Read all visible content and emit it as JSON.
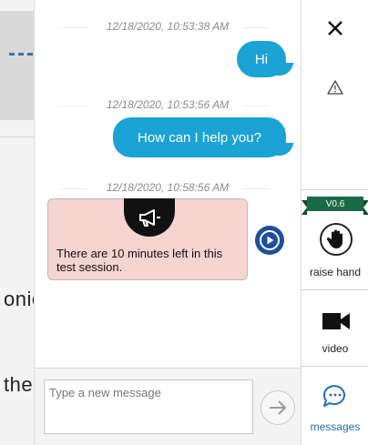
{
  "background_page": {
    "text_1": "onic",
    "text_2": "the"
  },
  "chat": {
    "messages": [
      {
        "timestamp": "12/18/2020, 10:53:38 AM",
        "text": "Hi"
      },
      {
        "timestamp": "12/18/2020, 10:53:56 AM",
        "text": "How can I help you?"
      },
      {
        "timestamp": "12/18/2020, 10:58:56 AM",
        "text": "There are 10 minutes left in this test session."
      }
    ],
    "colors": {
      "bubble": "#1aa3d4",
      "notice": "#f6d4d0",
      "play": "#1f4f98"
    }
  },
  "sidebar": {
    "close_icon": "close-icon",
    "alert_icon": "warning-icon",
    "version": "V0.6",
    "raise_hand_label": "raise hand",
    "video_label": "video",
    "messages_label": "messages",
    "accent": "#1a6b45",
    "messages_color": "#1f6fb5"
  },
  "composer": {
    "placeholder": "Type a new message",
    "value": ""
  }
}
